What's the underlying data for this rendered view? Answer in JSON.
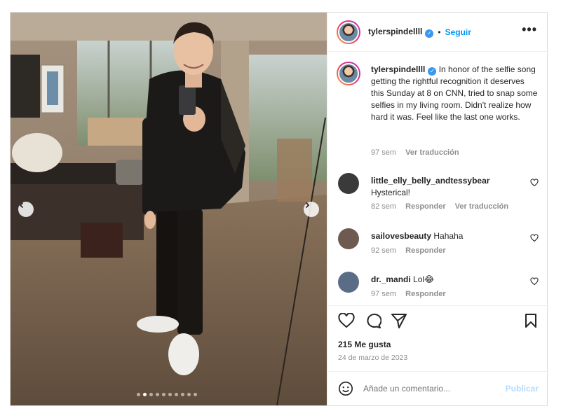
{
  "post": {
    "username": "tylerspindellll",
    "verified_icon": "verified-badge-icon",
    "separator": "•",
    "follow_label": "Seguir",
    "more_icon": "more-options-icon",
    "more_label": "•••"
  },
  "media": {
    "prev_icon": "chevron-left-icon",
    "next_icon": "chevron-right-icon",
    "slide_count": 10,
    "active_slide": 2
  },
  "caption": {
    "username": "tylerspindellll",
    "text": "In honor of the selfie song getting the rightful recognition it deserves this Sunday at 8 on CNN, tried to snap some selfies in my living room. Didn't realize how hard it was. Feel like the last one works.",
    "time": "97 sem",
    "translate": "Ver traducción"
  },
  "comments": [
    {
      "username": "little_elly_belly_andtessybear",
      "text": "Hysterical!",
      "time": "82 sem",
      "reply": "Responder",
      "translate": "Ver traducción",
      "avatar_color": "#3a3a3a"
    },
    {
      "username": "sailovesbeauty",
      "text": "Hahaha",
      "time": "92 sem",
      "reply": "Responder",
      "avatar_color": "#6e5a50"
    },
    {
      "username": "dr._mandi",
      "text": "Lol😂",
      "time": "97 sem",
      "reply": "Responder",
      "avatar_color": "#5b6d86"
    }
  ],
  "actions": {
    "like_icon": "heart-icon",
    "comment_icon": "comment-icon",
    "share_icon": "share-icon",
    "save_icon": "bookmark-icon"
  },
  "likes": "215 Me gusta",
  "date": "24 de marzo de 2023",
  "add_comment": {
    "emoji_icon": "emoji-icon",
    "placeholder": "Añade un comentario...",
    "post_label": "Publicar"
  },
  "colors": {
    "accent": "#0095f6",
    "muted": "#8e8e8e",
    "border": "#dbdbdb",
    "post_disabled": "#b3dbff"
  }
}
